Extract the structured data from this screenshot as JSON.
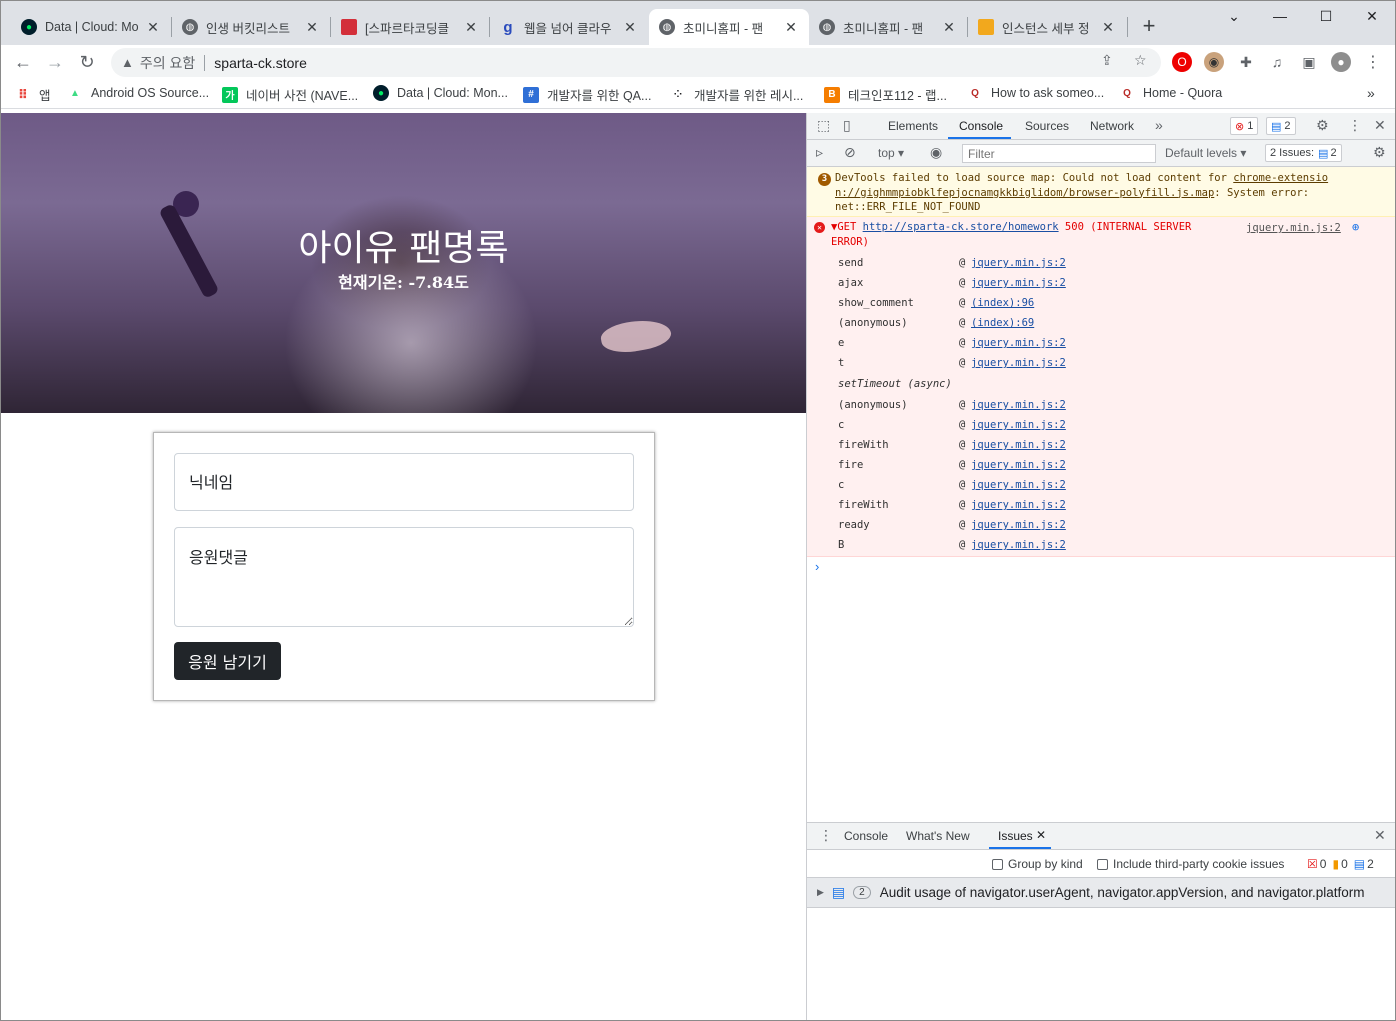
{
  "browser": {
    "tabs": [
      {
        "title": "Data | Cloud: Mo",
        "favicon": "mongodb-leaf-icon"
      },
      {
        "title": "인생 버킷리스트",
        "favicon": "globe-icon"
      },
      {
        "title": "[스파르타코딩클",
        "favicon": "book-icon"
      },
      {
        "title": "웹을 넘어 클라우",
        "favicon": "goorm-icon"
      },
      {
        "title": "초미니홈피 - 팬",
        "favicon": "globe-icon"
      },
      {
        "title": "초미니홈피 - 팬",
        "favicon": "globe-icon"
      },
      {
        "title": "인스턴스 세부 정",
        "favicon": "aws-box-icon"
      }
    ],
    "active_tab_index": 4,
    "address": {
      "security_label": "주의 요함",
      "url": "sparta-ck.store"
    },
    "bookmarks": [
      "앱",
      "Android OS Source...",
      "네이버 사전 (NAVE...",
      "Data | Cloud: Mon...",
      "개발자를 위한 QA...",
      "개발자를 위한 레시...",
      "테크인포112 - 랩...",
      "How to ask someo...",
      "Home - Quora"
    ]
  },
  "page": {
    "title": "아이유 팬명록",
    "temp_label": "현재기온: ",
    "temp_value": "-7.84",
    "temp_unit": "도",
    "form": {
      "nickname_placeholder": "닉네임",
      "comment_placeholder": "응원댓글",
      "submit_label": "응원 남기기"
    }
  },
  "devtools": {
    "tabs": [
      "Elements",
      "Console",
      "Sources",
      "Network"
    ],
    "active_tab": "Console",
    "error_count": "1",
    "message_count": "2",
    "context": "top",
    "filter_placeholder": "Filter",
    "levels": "Default levels",
    "issues_label": "2 Issues:",
    "issues_count": "2",
    "warning": {
      "text1": "DevTools failed to load source map: Could not load content for ",
      "link": "chrome-extension://gighmmpiobklfepjocnamgkkbiglidom/browser-polyfill.js.map",
      "link_line1": "chrome-extensio",
      "link_line2": "n://gighmmpiobklfepjocnamgkkbiglidom/browser-polyfill.js.map",
      "text2": ": System error:",
      "text3": "net::ERR_FILE_NOT_FOUND"
    },
    "error": {
      "method": "GET",
      "url": "http://sparta-ck.store/homework",
      "status_line1": "500 (INTERNAL SERVER",
      "status_line2": "ERROR)",
      "source": "jquery.min.js:2"
    },
    "stack": [
      {
        "fn": "send",
        "loc": "jquery.min.js:2"
      },
      {
        "fn": "ajax",
        "loc": "jquery.min.js:2"
      },
      {
        "fn": "show_comment",
        "loc": "(index):96"
      },
      {
        "fn": "(anonymous)",
        "loc": "(index):69"
      },
      {
        "fn": "e",
        "loc": "jquery.min.js:2"
      },
      {
        "fn": "t",
        "loc": "jquery.min.js:2"
      },
      {
        "fn": "setTimeout (async)",
        "loc": ""
      },
      {
        "fn": "(anonymous)",
        "loc": "jquery.min.js:2"
      },
      {
        "fn": "c",
        "loc": "jquery.min.js:2"
      },
      {
        "fn": "fireWith",
        "loc": "jquery.min.js:2"
      },
      {
        "fn": "fire",
        "loc": "jquery.min.js:2"
      },
      {
        "fn": "c",
        "loc": "jquery.min.js:2"
      },
      {
        "fn": "fireWith",
        "loc": "jquery.min.js:2"
      },
      {
        "fn": "ready",
        "loc": "jquery.min.js:2"
      },
      {
        "fn": "B",
        "loc": "jquery.min.js:2"
      }
    ],
    "drawer": {
      "tabs": [
        "Console",
        "What's New",
        "Issues"
      ],
      "active_tab": "Issues",
      "group_by_kind": "Group by kind",
      "third_party": "Include third-party cookie issues",
      "counts": {
        "errors": "0",
        "warnings": "0",
        "info": "2"
      },
      "issue_count": "2",
      "issue_text": "Audit usage of navigator.userAgent, navigator.appVersion, and navigator.platform"
    }
  },
  "colors": {
    "accent": "#1a73e8",
    "error": "#e41a1a",
    "button_dark": "#212529"
  }
}
